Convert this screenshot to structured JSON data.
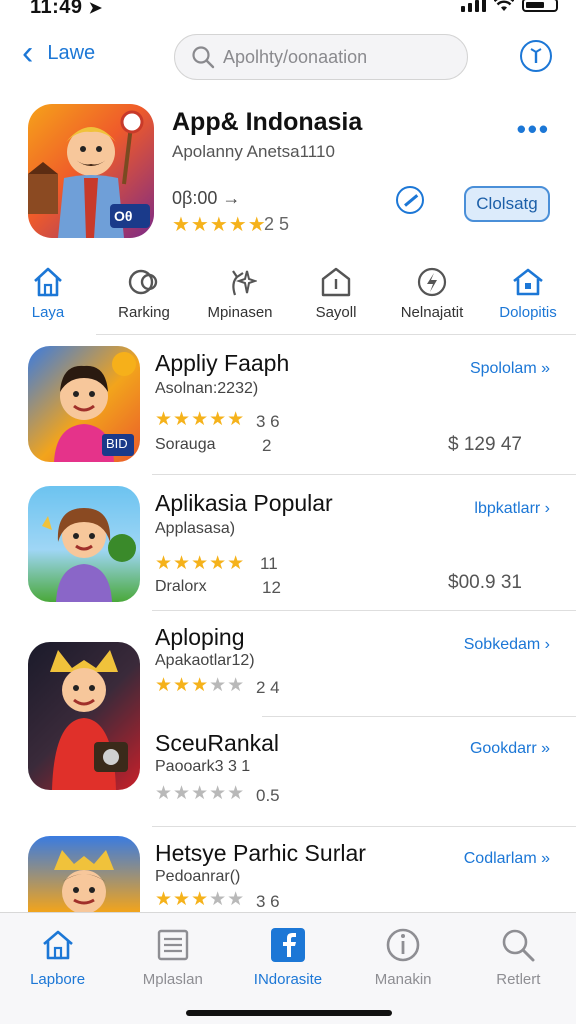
{
  "status": {
    "time": "11:49",
    "arrow": "➤"
  },
  "nav": {
    "back_label": "Lawe",
    "search_placeholder": "Apolhty/oonaation"
  },
  "featured": {
    "title": "App& Indonasia",
    "subtitle": "Apolanny Anetsa1110",
    "price": "0β:00 →",
    "stars": "★★★★★",
    "rating": "2 5",
    "button_label": "Clolsatg",
    "more": "•••",
    "icon_badge": "Oθ"
  },
  "categories": [
    {
      "label": "Laya",
      "icon": "home-icon",
      "active": true
    },
    {
      "label": "Rarking",
      "icon": "ranking-icon",
      "active": false
    },
    {
      "label": "Mpinasen",
      "icon": "sparkle-icon",
      "active": false
    },
    {
      "label": "Sayoll",
      "icon": "tent-icon",
      "active": false
    },
    {
      "label": "Nelnajatit",
      "icon": "bolt-icon",
      "active": false
    },
    {
      "label": "Dolopitis",
      "icon": "house-icon",
      "active": true
    }
  ],
  "apps": [
    {
      "title": "Appliy Faaph",
      "subtitle": "Asolnan:2232)",
      "stars_gold": "★★★★★",
      "stars_grey": "",
      "count": "3 6",
      "meta": "Sorauga",
      "num": "2",
      "link": "Spololam »",
      "price": "$ 129  47",
      "badge": "BID"
    },
    {
      "title": "Aplikasia Popular",
      "subtitle": "Applasasa)",
      "stars_gold": "★★★★★",
      "stars_grey": "",
      "count": "11",
      "meta": "Dralorx",
      "num": "12",
      "link": "lbpkatlarr ›",
      "price": "$00.9  31",
      "badge": ""
    },
    {
      "title": "Aploping",
      "subtitle": "Apakaotlar12)",
      "stars_gold": "★★★",
      "stars_grey": "★★",
      "count": "2 4",
      "meta": "",
      "num": "",
      "link": "Sobkedam ›",
      "price": "",
      "badge": ""
    },
    {
      "title": "SceuRankal",
      "subtitle": "Paooark3 3 1",
      "stars_gold": "",
      "stars_grey": "★★★★★",
      "count": "0.5",
      "meta": "",
      "num": "",
      "link": "Gookdarr »",
      "price": "",
      "badge": ""
    },
    {
      "title": "Hetsye Parhic Surlar",
      "subtitle": "Pedoanrar()",
      "stars_gold": "★★★",
      "stars_grey": "★★",
      "count": "3 6",
      "meta": "",
      "num": "",
      "link": "Codlarlam »",
      "price": "",
      "badge": ""
    }
  ],
  "tabs": [
    {
      "label": "Lapbore",
      "icon": "home-icon",
      "active": true
    },
    {
      "label": "Mplaslan",
      "icon": "news-icon",
      "active": false
    },
    {
      "label": "INdorasite",
      "icon": "facebook-icon",
      "active": true
    },
    {
      "label": "Manakin",
      "icon": "info-icon",
      "active": false
    },
    {
      "label": "Retlert",
      "icon": "search-icon",
      "active": false
    }
  ],
  "colors": {
    "accent": "#1c77d6",
    "star": "#f5b21b"
  }
}
